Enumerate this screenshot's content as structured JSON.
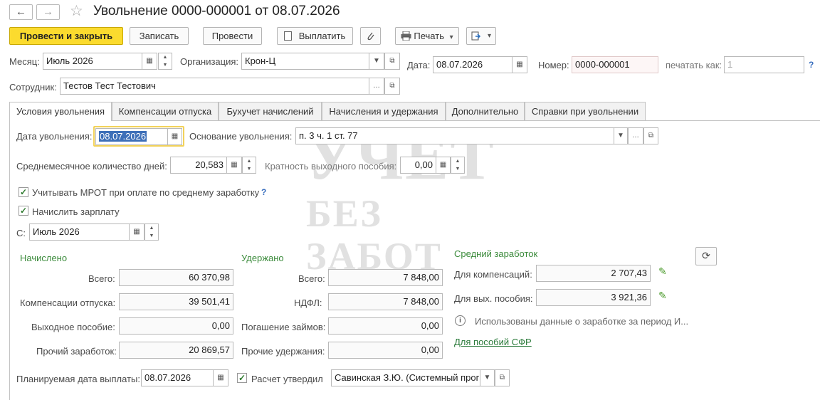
{
  "window": {
    "title": "Увольнение 0000-000001 от 08.07.2026"
  },
  "nav": {
    "back_icon": "←",
    "forward_icon": "→",
    "star_icon": "☆"
  },
  "toolbar": {
    "post_close": "Провести и закрыть",
    "save": "Записать",
    "post": "Провести",
    "pay": "Выплатить",
    "print": "Печать",
    "print_arrow": "▾",
    "create_arrow": "▾"
  },
  "header": {
    "month_label": "Месяц:",
    "month_value": "Июль 2026",
    "org_label": "Организация:",
    "org_value": "Крон-Ц",
    "date_label": "Дата:",
    "date_value": "08.07.2026",
    "number_label": "Номер:",
    "number_value": "0000-000001",
    "print_as_label": "печатать как:",
    "print_as_value": "1",
    "help": "?",
    "employee_label": "Сотрудник:",
    "employee_value": "Тестов Тест Тестович"
  },
  "tabs": [
    {
      "label": "Условия увольнения"
    },
    {
      "label": "Компенсации отпуска"
    },
    {
      "label": "Бухучет начислений"
    },
    {
      "label": "Начисления и удержания"
    },
    {
      "label": "Дополнительно"
    },
    {
      "label": "Справки при увольнении"
    }
  ],
  "conditions": {
    "dismissal_date_label": "Дата увольнения:",
    "dismissal_date_value": "08.07.2026",
    "reason_label": "Основание увольнения:",
    "reason_value": "п. 3 ч. 1 ст. 77",
    "avg_days_label": "Среднемесячное количество дней:",
    "avg_days_value": "20,583",
    "severance_mult_label": "Кратность выходного пособия:",
    "severance_mult_value": "0,00",
    "mrot_label": "Учитывать МРОТ при оплате по среднему заработку",
    "mrot_help": "?",
    "accrue_salary_label": "Начислить зарплату",
    "from_label": "С:",
    "from_value": "Июль 2026"
  },
  "accrued": {
    "title": "Начислено",
    "total_label": "Всего:",
    "total_value": "60 370,98",
    "vacation_label": "Компенсации отпуска:",
    "vacation_value": "39 501,41",
    "severance_label": "Выходное пособие:",
    "severance_value": "0,00",
    "other_label": "Прочий заработок:",
    "other_value": "20 869,57"
  },
  "withheld": {
    "title": "Удержано",
    "total_label": "Всего:",
    "total_value": "7 848,00",
    "ndfl_label": "НДФЛ:",
    "ndfl_value": "7 848,00",
    "loans_label": "Погашение займов:",
    "loans_value": "0,00",
    "other_label": "Прочие удержания:",
    "other_value": "0,00"
  },
  "avg_earnings": {
    "title": "Средний заработок",
    "comp_label": "Для компенсаций:",
    "comp_value": "2 707,43",
    "sev_label": "Для вых. пособия:",
    "sev_value": "3 921,36",
    "info_text": "Использованы данные о заработке за период И...",
    "sfr_link": "Для пособий СФР"
  },
  "footer": {
    "pay_date_label": "Планируемая дата выплаты:",
    "pay_date_value": "08.07.2026",
    "approved_label": "Расчет утвердил",
    "approved_value": "Савинская З.Ю. (Системный прог"
  },
  "watermark": {
    "line1": "УЧЕТ",
    "line2": "БЕЗ ЗАБОТ"
  }
}
